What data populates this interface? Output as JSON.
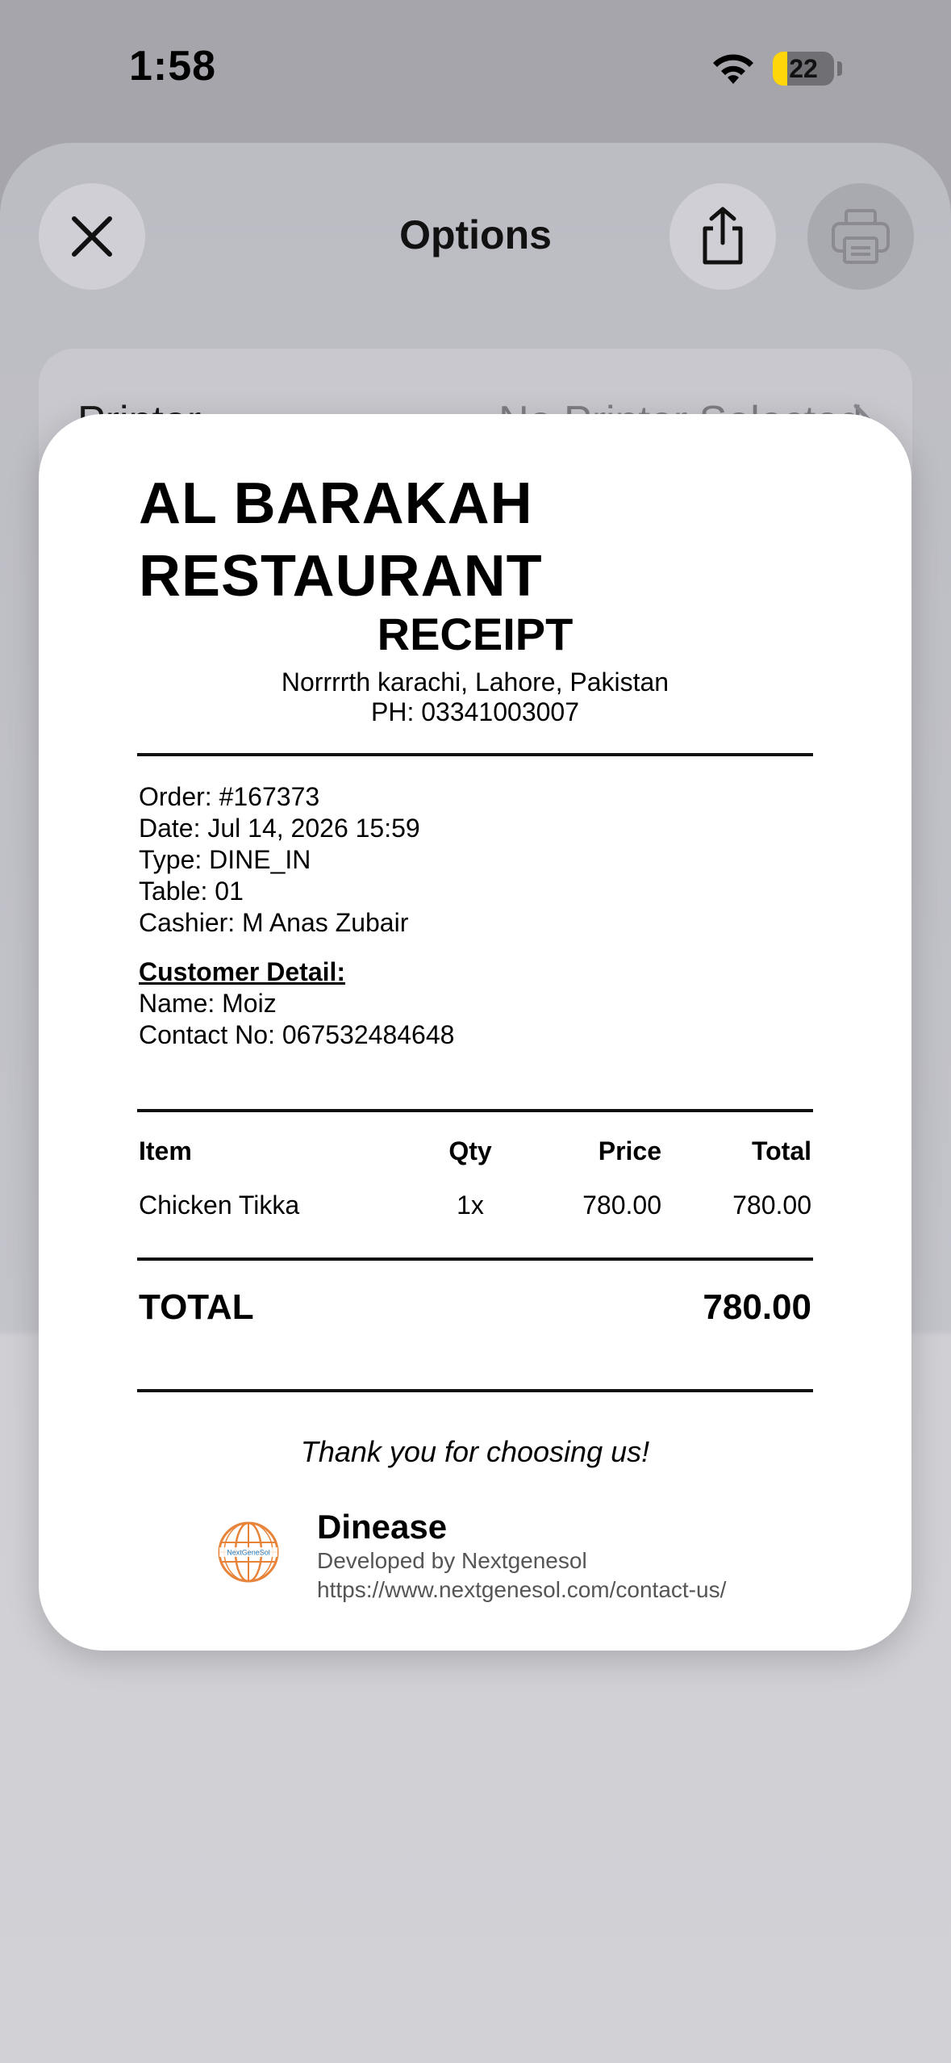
{
  "status_bar": {
    "time": "1:58",
    "battery_level": "22",
    "battery_color": "#ffd60a"
  },
  "sheet": {
    "title": "Options",
    "close_icon": "close-icon",
    "share_icon": "share-icon",
    "print_icon": "printer-icon",
    "printer_row": {
      "label": "Printer",
      "value": "No Printer Selected",
      "icon": "chevron-right-icon"
    }
  },
  "receipt": {
    "restaurant_name": "AL BARAKAH RESTAURANT",
    "title": "RECEIPT",
    "address": "Norrrrth karachi, Lahore, Pakistan",
    "phone": "PH: 03341003007",
    "order": "Order: #167373",
    "date": "Date: Jul 14, 2026 15:59",
    "type": "Type: DINE_IN",
    "table": "Table: 01",
    "cashier": "Cashier: M Anas Zubair",
    "customer_heading": "Customer Detail:",
    "customer_name": "Name: Moiz",
    "customer_contact": "Contact No: 067532484648",
    "columns": {
      "item": "Item",
      "qty": "Qty",
      "price": "Price",
      "total": "Total"
    },
    "items": [
      {
        "item": "Chicken Tikka",
        "qty": "1x",
        "price": "780.00",
        "total": "780.00"
      }
    ],
    "total_label": "TOTAL",
    "total_value": "780.00",
    "thank_you": "Thank you for choosing us!",
    "footer": {
      "logo_icon": "nextgenesol-globe-logo",
      "logo_text": "NextGeneSol",
      "brand": "Dinease",
      "developed_by": "Developed by Nextgenesol",
      "url": "https://www.nextgenesol.com/contact-us/"
    }
  }
}
